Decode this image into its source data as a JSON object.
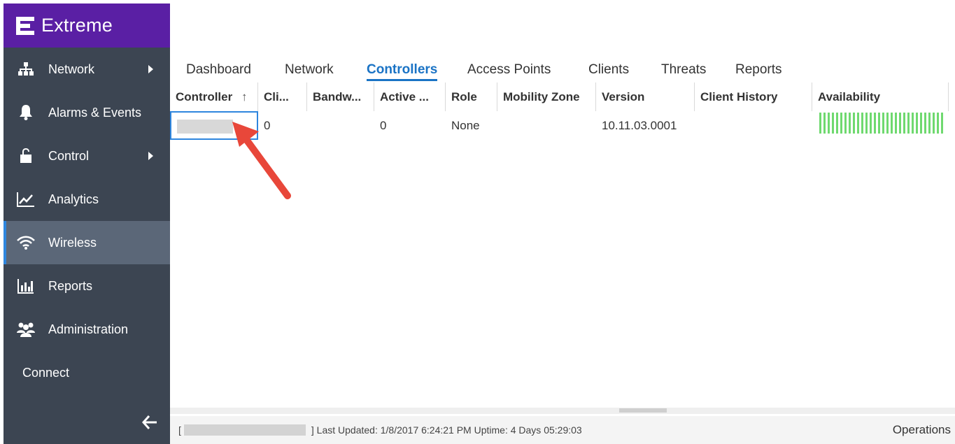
{
  "brand": {
    "name": "Extreme"
  },
  "sidebar": {
    "items": [
      {
        "label": "Network",
        "icon": "network-icon",
        "has_submenu": true
      },
      {
        "label": "Alarms & Events",
        "icon": "bell-icon",
        "has_submenu": false
      },
      {
        "label": "Control",
        "icon": "lock-icon",
        "has_submenu": true
      },
      {
        "label": "Analytics",
        "icon": "analytics-chart-icon",
        "has_submenu": false
      },
      {
        "label": "Wireless",
        "icon": "wifi-icon",
        "has_submenu": false,
        "active": true
      },
      {
        "label": "Reports",
        "icon": "bar-chart-icon",
        "has_submenu": false
      },
      {
        "label": "Administration",
        "icon": "users-icon",
        "has_submenu": false
      },
      {
        "label": "Connect",
        "icon": "",
        "has_submenu": false
      }
    ],
    "collapse_icon": "arrow-left-icon"
  },
  "tabs": [
    {
      "label": "Dashboard"
    },
    {
      "label": "Network"
    },
    {
      "label": "Controllers",
      "active": true
    },
    {
      "label": "Access Points"
    },
    {
      "label": "Clients"
    },
    {
      "label": "Threats"
    },
    {
      "label": "Reports"
    }
  ],
  "table": {
    "columns": [
      {
        "label": "Controller",
        "sort": "ascending"
      },
      {
        "label": "Cli..."
      },
      {
        "label": "Bandw..."
      },
      {
        "label": "Active ..."
      },
      {
        "label": "Role"
      },
      {
        "label": "Mobility Zone"
      },
      {
        "label": "Version"
      },
      {
        "label": "Client History"
      },
      {
        "label": "Availability"
      }
    ],
    "rows": [
      {
        "controller": "...",
        "clients": "0",
        "bandwidth": "",
        "active": "0",
        "role": "None",
        "mobility_zone": "",
        "version": "10.11.03.0001",
        "client_history": ""
      }
    ]
  },
  "status_bar": {
    "left_bracket": "[",
    "right_text": "] Last Updated: 1/8/2017 6:24:21 PM  Uptime: 4 Days 05:29:03",
    "right_label": "Operations"
  },
  "colors": {
    "sidebar_bg": "#3c4552",
    "brand_purple": "#5a1fa4",
    "active_tab": "#1a73c5",
    "availability_green": "#6fd96f",
    "annotation_arrow": "#e8473a"
  }
}
